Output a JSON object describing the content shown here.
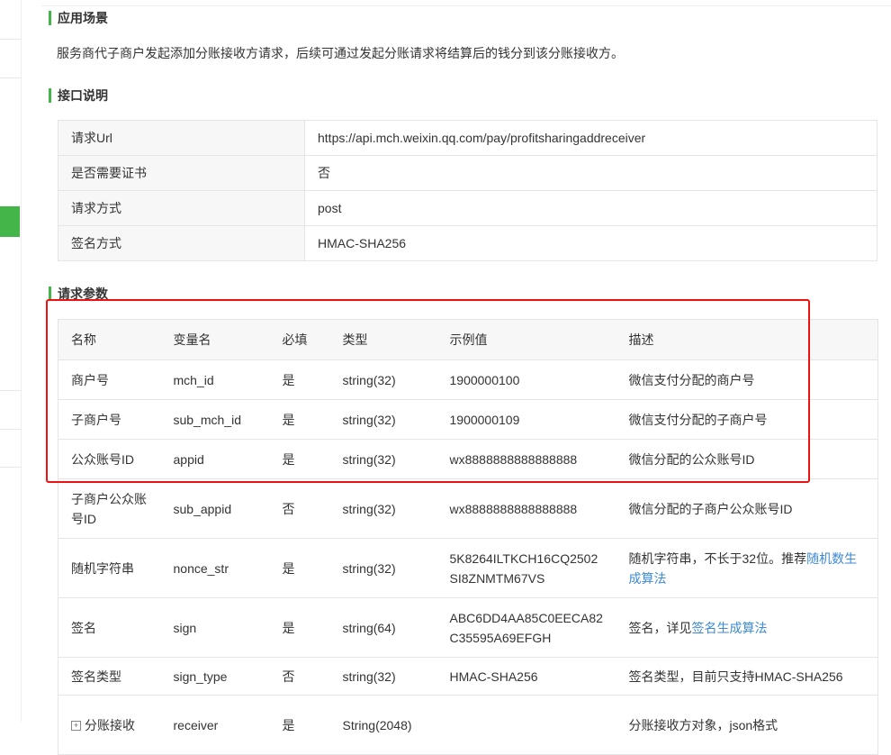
{
  "sections": {
    "scene_title": "应用场景",
    "scene_desc": "服务商代子商户发起添加分账接收方请求，后续可通过发起分账请求将结算后的钱分到该分账接收方。",
    "api_title": "接口说明",
    "params_title": "请求参数"
  },
  "api_info": [
    {
      "key": "请求Url",
      "value": "https://api.mch.weixin.qq.com/pay/profitsharingaddreceiver"
    },
    {
      "key": "是否需要证书",
      "value": "否"
    },
    {
      "key": "请求方式",
      "value": "post"
    },
    {
      "key": "签名方式",
      "value": "HMAC-SHA256"
    }
  ],
  "params": {
    "headers": [
      "名称",
      "变量名",
      "必填",
      "类型",
      "示例值",
      "描述"
    ],
    "rows": [
      {
        "name": "商户号",
        "var": "mch_id",
        "required": "是",
        "type": "string(32)",
        "example": "1900000100",
        "desc": "微信支付分配的商户号"
      },
      {
        "name": "子商户号",
        "var": "sub_mch_id",
        "required": "是",
        "type": "string(32)",
        "example": "1900000109",
        "desc": "微信支付分配的子商户号"
      },
      {
        "name": "公众账号ID",
        "var": "appid",
        "required": "是",
        "type": "string(32)",
        "example": "wx8888888888888888",
        "desc": "微信分配的公众账号ID"
      },
      {
        "name": "子商户公众账号ID",
        "var": "sub_appid",
        "required": "否",
        "type": "string(32)",
        "example": "wx8888888888888888",
        "desc": "微信分配的子商户公众账号ID"
      },
      {
        "name": "随机字符串",
        "var": "nonce_str",
        "required": "是",
        "type": "string(32)",
        "example": "5K8264ILTKCH16CQ2502SI8ZNMTM67VS",
        "desc_text": "随机字符串，不长于32位。推荐",
        "desc_link": "随机数生成算法"
      },
      {
        "name": "签名",
        "var": "sign",
        "required": "是",
        "type": "string(64)",
        "example": "ABC6DD4AA85C0EECA82C35595A69EFGH",
        "desc_text": "签名，详见",
        "desc_link": "签名生成算法"
      },
      {
        "name": "签名类型",
        "var": "sign_type",
        "required": "否",
        "type": "string(32)",
        "example": "HMAC-SHA256",
        "desc": "签名类型，目前只支持HMAC-SHA256"
      },
      {
        "expand_icon": "plus-expand-icon",
        "name": "分账接收",
        "var": "receiver",
        "required": "是",
        "type": "String(2048)",
        "example": "",
        "desc": "分账接收方对象，json格式"
      }
    ]
  },
  "colors": {
    "accent": "#44b549",
    "link": "#3c8ad8",
    "warning": "#e8180c",
    "highlight": "#ee1111"
  }
}
